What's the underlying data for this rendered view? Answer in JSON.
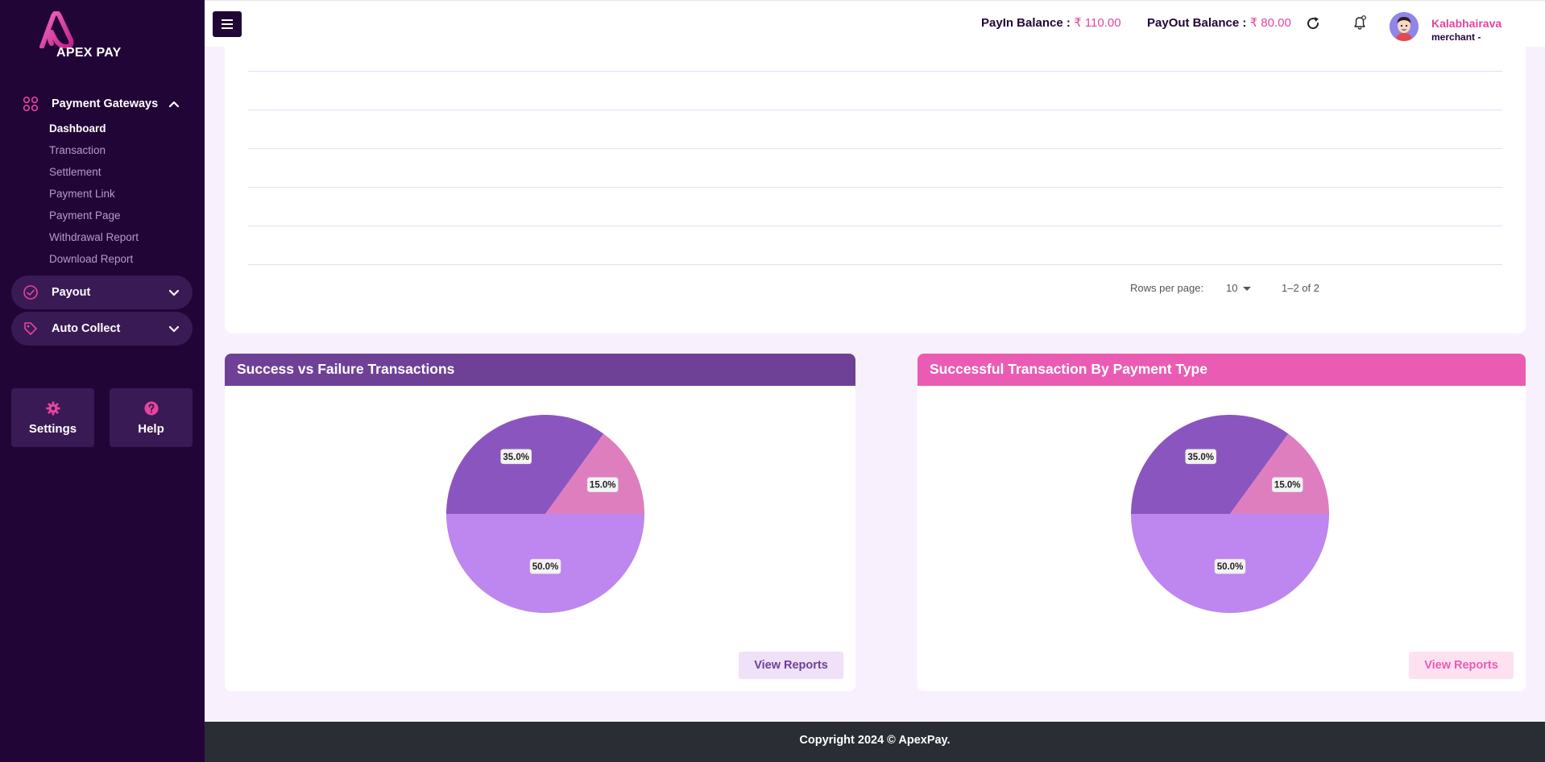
{
  "brand": {
    "name": "APEX PAY",
    "accent": "#e4449f",
    "dark": "#220537"
  },
  "sidebar": {
    "groups": [
      {
        "label": "Payment Gateways",
        "icon": "grid-icon",
        "expanded": true,
        "items": [
          "Dashboard",
          "Transaction",
          "Settlement",
          "Payment Link",
          "Payment Page",
          "Withdrawal Report",
          "Download Report"
        ],
        "active_item": "Dashboard"
      },
      {
        "label": "Payout",
        "icon": "check-circle-icon",
        "expanded": false
      },
      {
        "label": "Auto Collect",
        "icon": "tag-icon",
        "expanded": false
      }
    ],
    "tiles": [
      {
        "label": "Settings",
        "icon": "gear-icon"
      },
      {
        "label": "Help",
        "icon": "help-icon"
      }
    ]
  },
  "header": {
    "payin_label": "PayIn Balance :",
    "payin_amount": "₹ 110.00",
    "payout_label": "PayOut Balance :",
    "payout_amount": "₹ 80.00",
    "user_name": "Kalabhairava",
    "user_role": "merchant -"
  },
  "table": {
    "rows_per_page_label": "Rows per page:",
    "rows_per_page_value": "10",
    "range_text": "1–2 of 2"
  },
  "charts": [
    {
      "title": "Success vs Failure Transactions",
      "button": "View Reports",
      "header_color": "#6e4196"
    },
    {
      "title": "Successful Transaction By Payment Type",
      "button": "View Reports",
      "header_color": "#ea5cb3"
    }
  ],
  "chart_data": [
    {
      "type": "pie",
      "slices": [
        {
          "value": 35.0,
          "label": "35.0%",
          "color": "#8b55c0"
        },
        {
          "value": 15.0,
          "label": "15.0%",
          "color": "#de7ebf"
        },
        {
          "value": 50.0,
          "label": "50.0%",
          "color": "#be86ef"
        }
      ]
    },
    {
      "type": "pie",
      "slices": [
        {
          "value": 35.0,
          "label": "35.0%",
          "color": "#8b55c0"
        },
        {
          "value": 15.0,
          "label": "15.0%",
          "color": "#de7ebf"
        },
        {
          "value": 50.0,
          "label": "50.0%",
          "color": "#be86ef"
        }
      ]
    }
  ],
  "footer": {
    "text": "Copyright 2024 © ApexPay."
  }
}
